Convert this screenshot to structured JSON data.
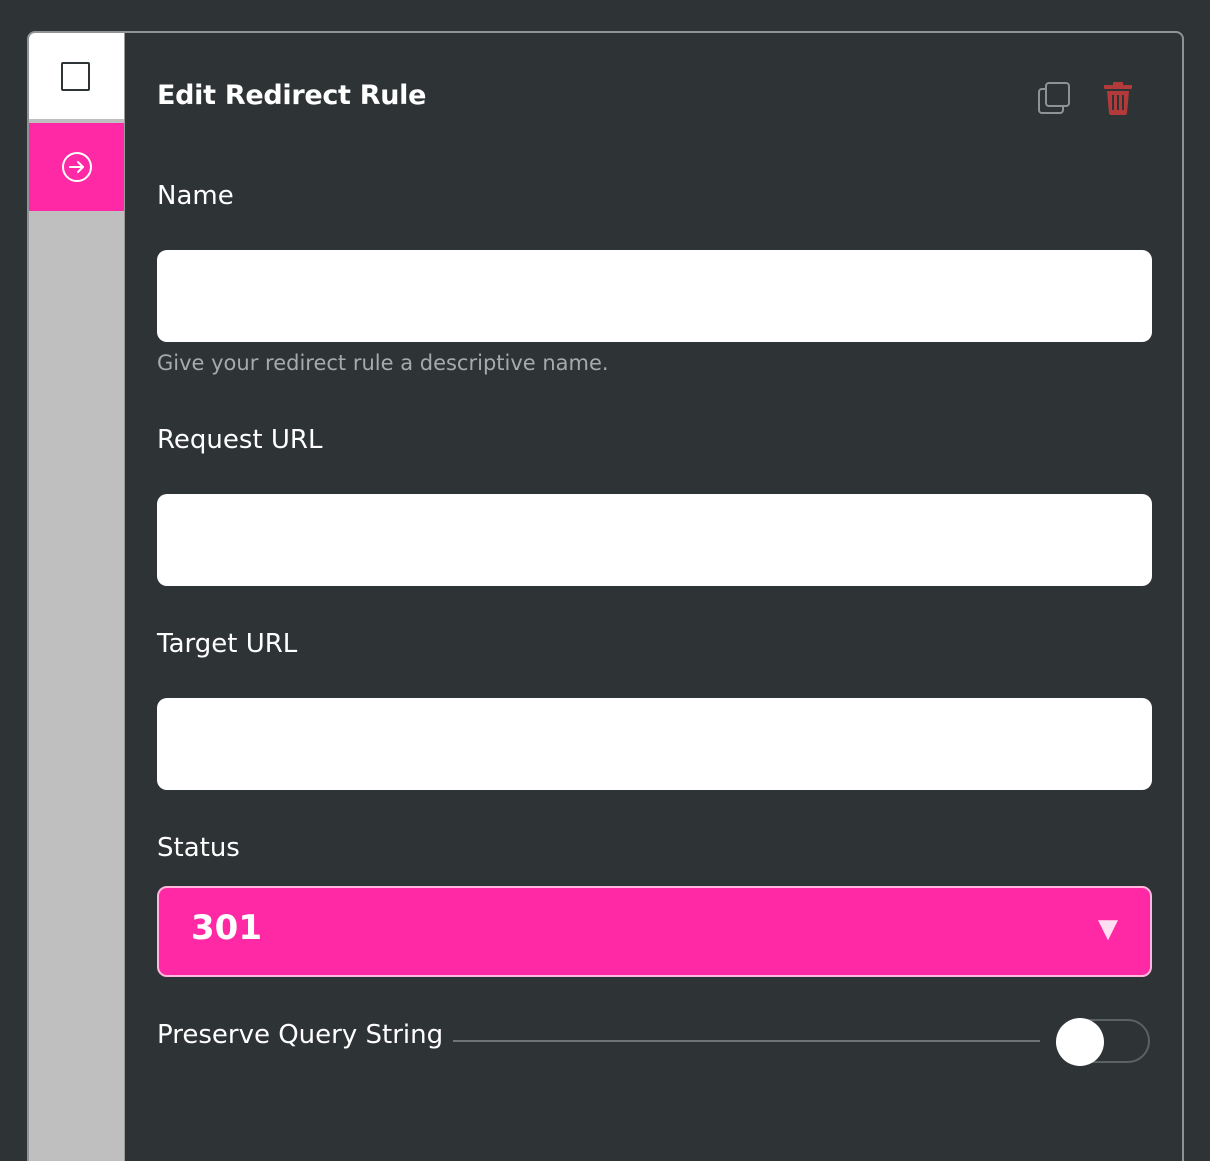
{
  "form": {
    "title": "Edit Redirect Rule",
    "name": {
      "label": "Name",
      "value": "",
      "placeholder": "",
      "hint": "Give your redirect rule a descriptive name."
    },
    "request_url": {
      "label": "Request URL",
      "value": "",
      "placeholder": ""
    },
    "target_url": {
      "label": "Target URL",
      "value": "",
      "placeholder": ""
    },
    "status": {
      "label": "Status",
      "selected": "301"
    },
    "preserve_query_string": {
      "label": "Preserve Query String",
      "enabled": false
    }
  },
  "icons": {
    "rail_checkbox": "checkbox-icon",
    "rail_arrow": "arrow-right-circle-icon",
    "copy": "copy-icon",
    "delete": "trash-icon"
  },
  "colors": {
    "accent": "#ff29a5",
    "background": "#2e3336",
    "delete": "#b33a3a",
    "rail": "#bfbfbf"
  }
}
